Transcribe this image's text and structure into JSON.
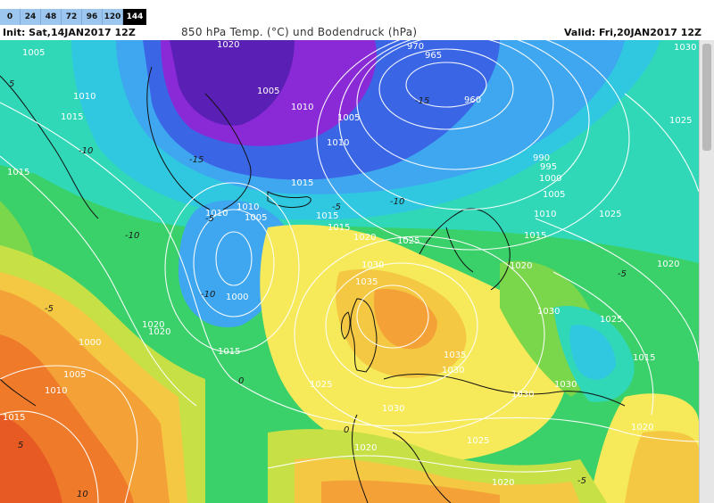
{
  "forecast_hours": [
    "0",
    "24",
    "48",
    "72",
    "96",
    "120",
    "144"
  ],
  "active_hour": "144",
  "header": {
    "init": "Init: Sat,14JAN2017 12Z",
    "title": "850 hPa Temp. (°C) und Bodendruck (hPa)",
    "valid": "Valid: Fri,20JAN2017 12Z"
  },
  "pressure_labels": [
    "1005",
    "1020",
    "970",
    "965",
    "960",
    "1030",
    "1010",
    "1015",
    "1005",
    "1010",
    "1005",
    "1010",
    "1025",
    "1015",
    "990",
    "995",
    "1000",
    "1005",
    "1015",
    "1010",
    "1010",
    "1005",
    "1015",
    "1015",
    "1010",
    "1020",
    "1025",
    "1015",
    "1025",
    "1030",
    "1020",
    "1020",
    "1000",
    "1035",
    "1030",
    "1025",
    "1020",
    "1020",
    "1000",
    "1015",
    "1005",
    "1035",
    "1030",
    "1015",
    "1010",
    "1025",
    "1030",
    "1030",
    "1030",
    "1015",
    "1020",
    "1025",
    "1020",
    "1020"
  ],
  "temp_labels": [
    "5",
    "-10",
    "-15",
    "-15",
    "-5",
    "-10",
    "-5",
    "-10",
    "-10",
    "-5",
    "0",
    "5",
    "-5",
    "0",
    "-5",
    "10"
  ],
  "colors": {
    "deep_purple": "#5a1fb4",
    "violet": "#8a2ad6",
    "blue": "#3a66e6",
    "light_blue": "#3fa6f0",
    "cyan": "#2fc8e0",
    "teal": "#30d8b8",
    "green": "#3ad06a",
    "light_green": "#7ad64a",
    "yellow_green": "#c6e046",
    "yellow": "#f6ea5a",
    "gold": "#f4c842",
    "orange": "#f4a238",
    "dark_orange": "#ee7a2a",
    "red_orange": "#e85a24",
    "isobar": "#ffffff",
    "coastline": "#111111",
    "tab_bg": "#9cc6ee",
    "tab_active_bg": "#000000"
  }
}
